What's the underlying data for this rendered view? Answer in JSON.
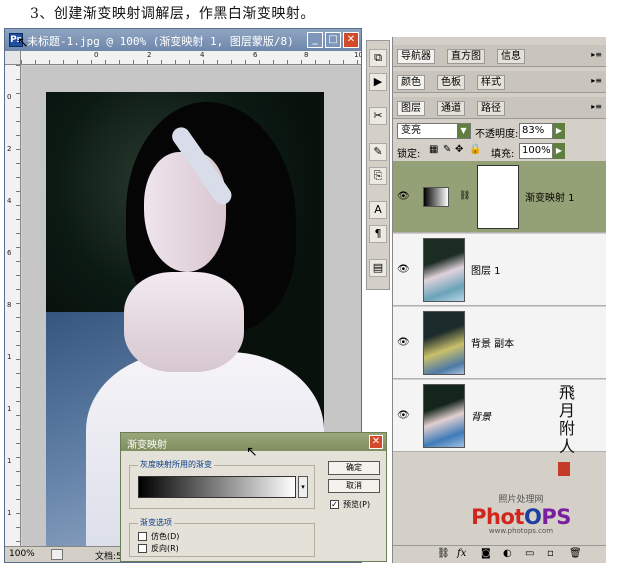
{
  "caption": "3、创建渐变映射调解层，作黑白渐变映射。",
  "document": {
    "title": "未标题-1.jpg @ 100% (渐变映射 1, 图层蒙版/8)",
    "ruler_h_ticks": [
      "0",
      "2",
      "4",
      "6",
      "8",
      "10"
    ],
    "ruler_v_ticks": [
      "0",
      "2",
      "4",
      "6",
      "8",
      "1",
      "1",
      "1",
      "1"
    ],
    "zoom": "100%",
    "status_doc": "文档:5"
  },
  "dialog": {
    "title": "渐变映射",
    "group_gradient": "灰度映射所用的渐变",
    "group_options": "渐变选项",
    "ok": "确定",
    "cancel": "取消",
    "preview": "预览(P)",
    "dither": "仿色(D)",
    "reverse": "反向(R)"
  },
  "panels": {
    "row1_tabs": [
      "导航器",
      "直方图",
      "信息"
    ],
    "row2_tabs": [
      "颜色",
      "色板",
      "样式"
    ],
    "row3_tabs": [
      "图层",
      "通道",
      "路径"
    ],
    "blend_mode": "变亮",
    "opacity_label": "不透明度:",
    "opacity_value": "83%",
    "lock_label": "锁定:",
    "fill_label": "填充:",
    "fill_value": "100%",
    "layers": [
      {
        "name": "渐变映射 1"
      },
      {
        "name": "图层 1"
      },
      {
        "name": "背景 副本"
      },
      {
        "name": "背景"
      }
    ]
  },
  "watermark": {
    "site": "照片处理网",
    "logo": "PhotoPS",
    "url": "www.photops.com"
  }
}
